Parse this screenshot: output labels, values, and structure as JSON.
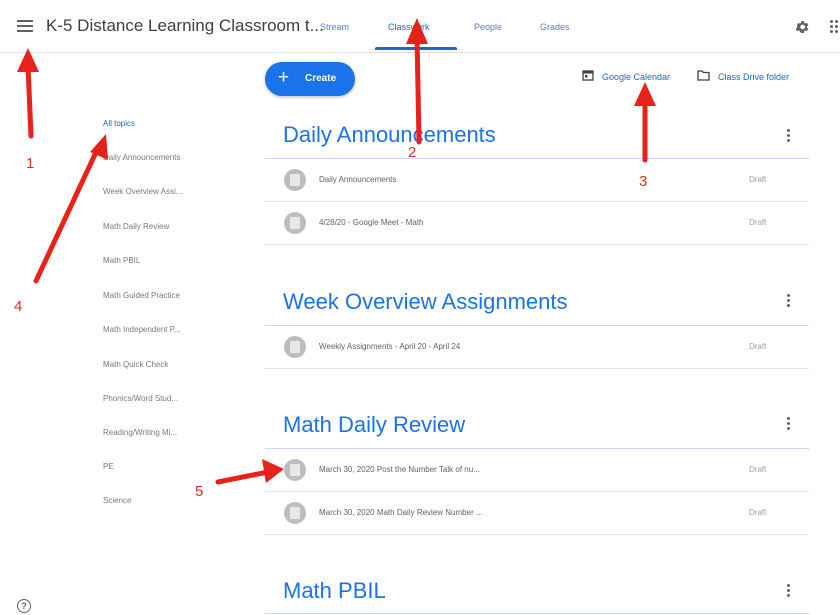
{
  "header": {
    "class_title": "K-5 Distance Learning Classroom t...",
    "tabs": [
      {
        "label": "Stream"
      },
      {
        "label": "Classwork",
        "active": true
      },
      {
        "label": "People"
      },
      {
        "label": "Grades"
      }
    ]
  },
  "toolbar": {
    "create_label": "Create",
    "plus_glyph": "+",
    "calendar_link": "Google Calendar",
    "drive_link": "Class Drive folder"
  },
  "sidebar": {
    "topics": [
      {
        "label": "All topics",
        "active": true
      },
      {
        "label": "Daily Announcements"
      },
      {
        "label": "Week Overview Assi..."
      },
      {
        "label": "Math Daily Review"
      },
      {
        "label": "Math PBIL"
      },
      {
        "label": "Math Guided Practice"
      },
      {
        "label": "Math Independent P..."
      },
      {
        "label": "Math Quick Check"
      },
      {
        "label": "Phonics/Word Stud..."
      },
      {
        "label": "Reading/Writing Mi..."
      },
      {
        "label": "PE"
      },
      {
        "label": "Science"
      }
    ]
  },
  "sections": [
    {
      "title": "Daily Announcements",
      "items": [
        {
          "title": "Daily Announcements",
          "status": "Draft"
        },
        {
          "title": "4/28/20 - Google Meet - Math",
          "status": "Draft"
        }
      ]
    },
    {
      "title": "Week Overview Assignments",
      "items": [
        {
          "title": "Weekly Assignments - April 20 - April 24",
          "status": "Draft"
        }
      ]
    },
    {
      "title": "Math Daily Review",
      "items": [
        {
          "title": "March 30, 2020 Post the Number Talk of nu...",
          "status": "Draft"
        },
        {
          "title": "March 30, 2020 Math Daily Review Number ...",
          "status": "Draft"
        }
      ]
    },
    {
      "title": "Math PBIL",
      "items": []
    }
  ],
  "annotations": [
    "1",
    "2",
    "3",
    "4",
    "5"
  ],
  "help_glyph": "?",
  "colors": {
    "accent": "#1a73e8",
    "annotation": "#d93025"
  }
}
